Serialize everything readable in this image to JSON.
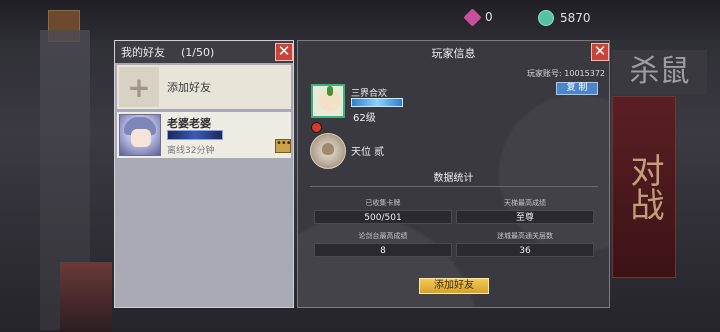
{
  "currency": {
    "gems": "0",
    "jade": "5870"
  },
  "background": {
    "banner_text": "对战",
    "top_right_text": "杀鼠"
  },
  "friends_panel": {
    "title": "我的好友",
    "count": "(1/50)",
    "add_friend_label": "添加好友",
    "friends": [
      {
        "name": "老婆老婆",
        "status": "离线32分钟"
      }
    ]
  },
  "player_info": {
    "title": "玩家信息",
    "account_label": "玩家账号:",
    "account_id": "10015372",
    "copy_label": "复 制",
    "name": "三界合欢",
    "level": "62级",
    "rank": "天位 贰",
    "stats_title": "数据统计",
    "stats": [
      {
        "label": "已收集卡牌",
        "value": "500/501"
      },
      {
        "label": "天梯最高成绩",
        "value": "至尊"
      },
      {
        "label": "论剑台最高成绩",
        "value": "8"
      },
      {
        "label": "迷城最高通关层数",
        "value": "36"
      }
    ],
    "add_friend_button": "添加好友"
  },
  "colors": {
    "close": "#c84339",
    "copy": "#4a86c8",
    "add_button": "#e6b440",
    "panel": "#3a3940"
  }
}
